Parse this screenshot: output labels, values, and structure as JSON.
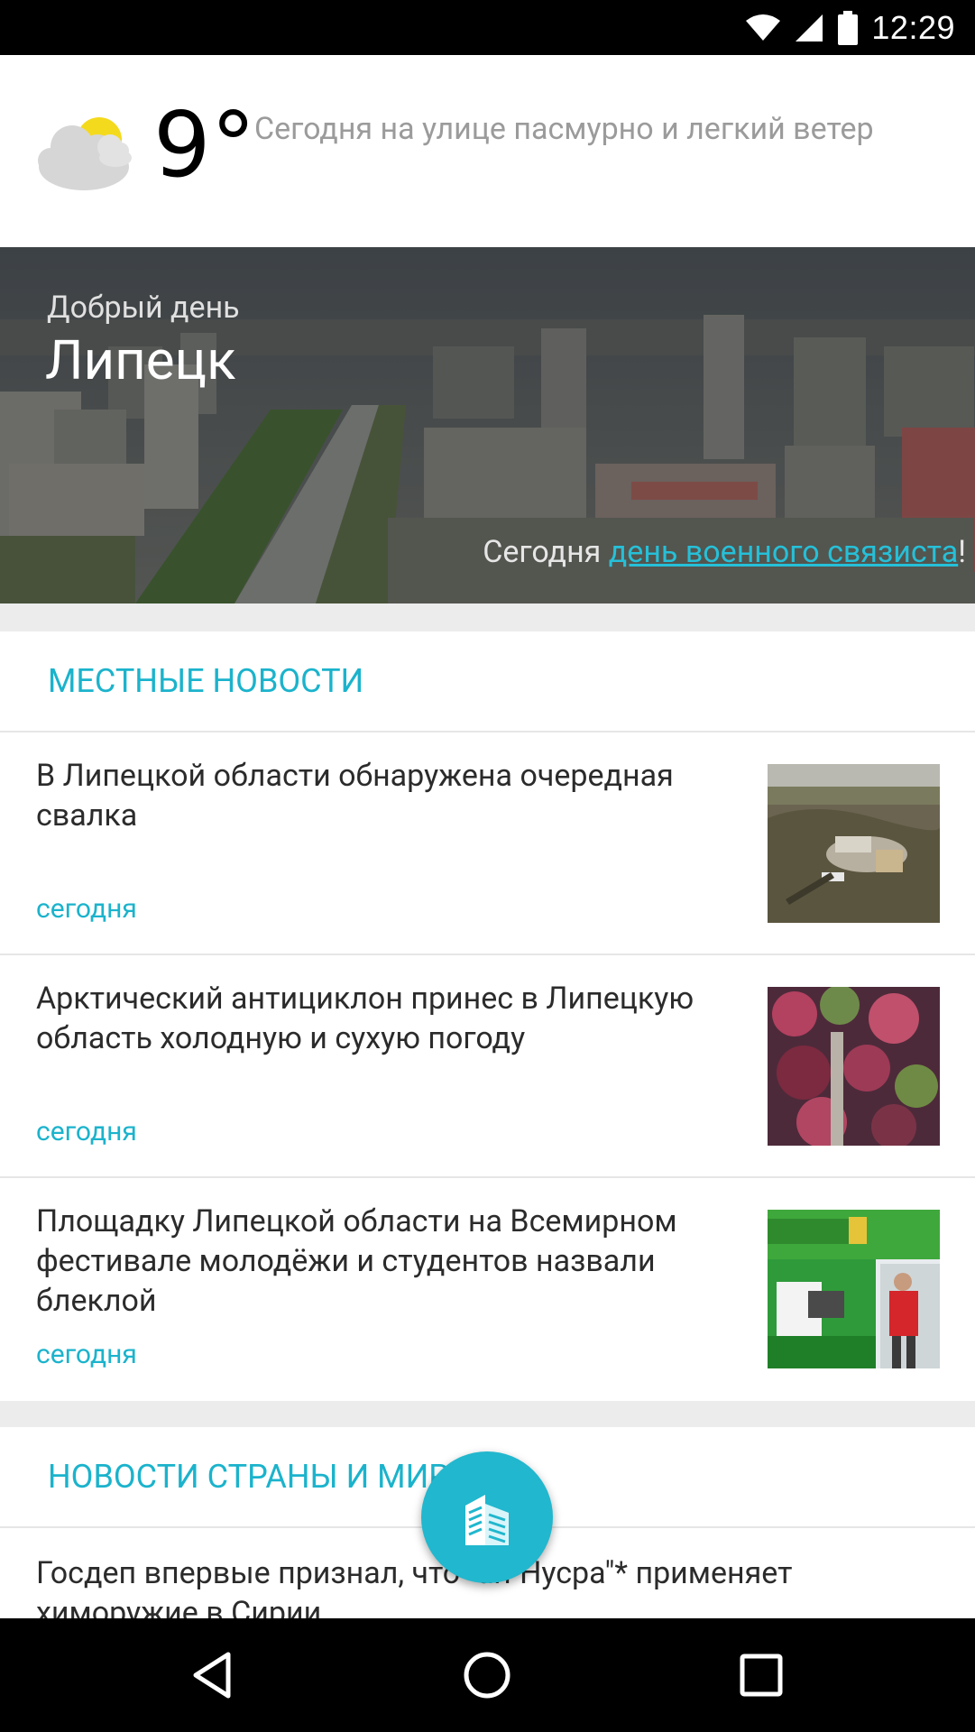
{
  "status_bar": {
    "time": "12:29"
  },
  "weather": {
    "icon": "partly-cloudy-icon",
    "temperature": "9°",
    "description": "Сегодня на улице пасмурно и легкий ветер"
  },
  "hero": {
    "greeting": "Добрый день",
    "city": "Липецк",
    "holiday_prefix": "Сегодня ",
    "holiday_link": "день военного связиста",
    "holiday_suffix": "!"
  },
  "local_news": {
    "title": "МЕСТНЫЕ НОВОСТИ",
    "items": [
      {
        "headline": "В Липецкой области обнаружена очередная свалка",
        "date": "сегодня"
      },
      {
        "headline": "Арктический антициклон принес в Липецкую область холодную и сухую погоду",
        "date": "сегодня"
      },
      {
        "headline": "Площадку Липецкой области на Всемирном фестивале молодёжи и студентов назвали блеклой",
        "date": "сегодня"
      }
    ]
  },
  "world_news": {
    "title": "НОВОСТИ СТРАНЫ И МИРА",
    "items": [
      {
        "headline": "Госдеп впервые признал, что \"ан-Нусра\"* применяет химоружие в Сирии"
      }
    ]
  },
  "fab": {
    "icon": "city-buildings-icon"
  },
  "nav_bar": {
    "back": "back-icon",
    "home": "home-icon",
    "recents": "recents-icon"
  },
  "colors": {
    "accent": "#1bb3cc",
    "fab": "#21b7ce",
    "link": "#26c0d8"
  }
}
